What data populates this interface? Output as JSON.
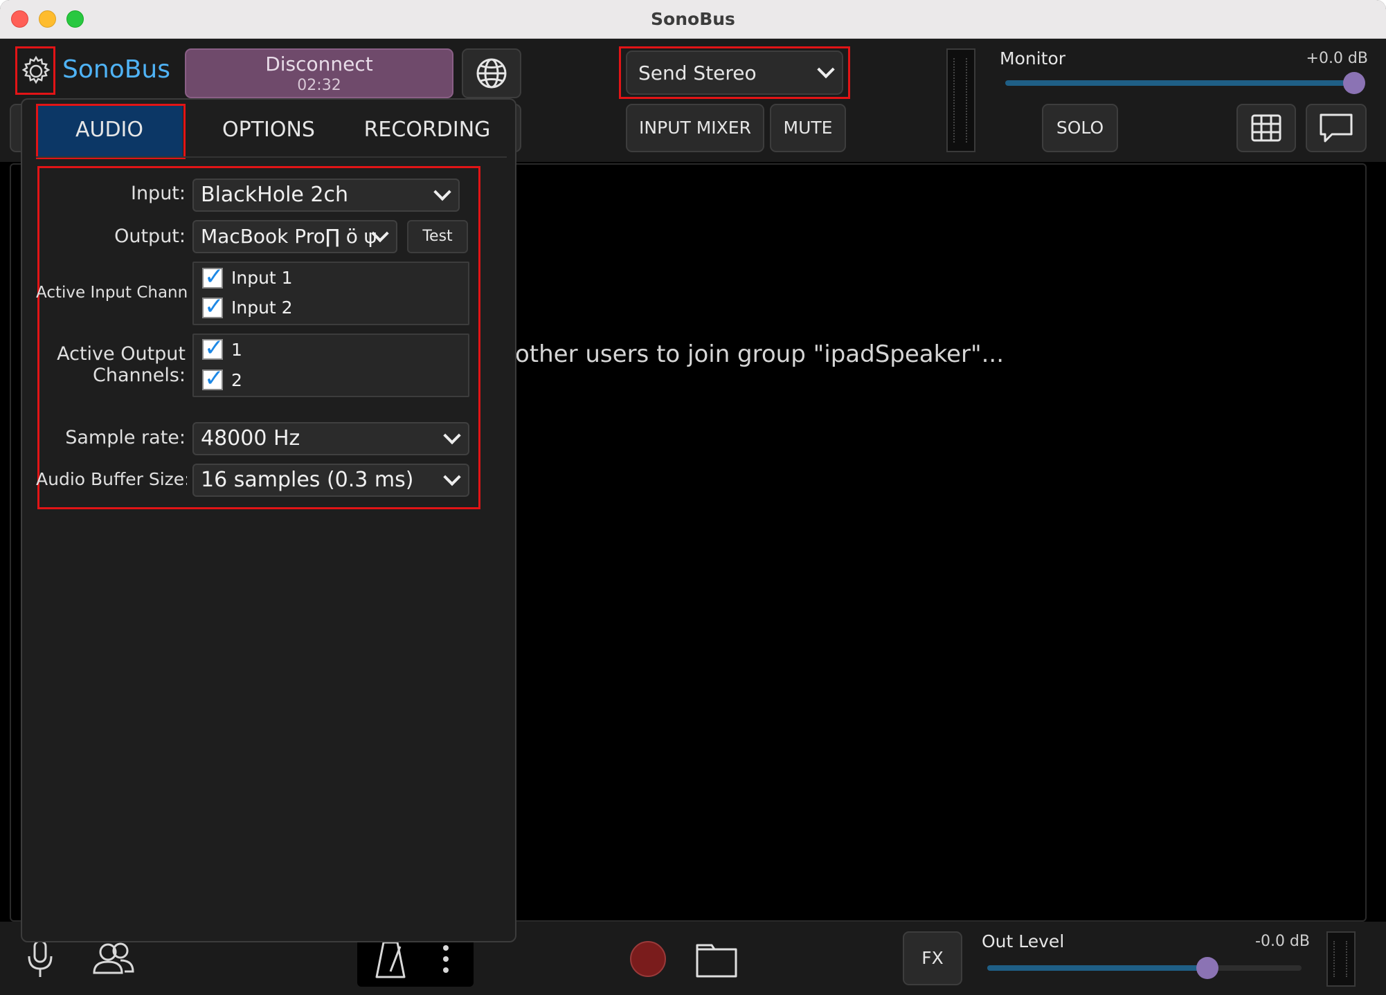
{
  "window": {
    "title": "SonoBus",
    "colors": {
      "close": "#ff5f57",
      "minimize": "#febc2e",
      "zoom": "#28c840"
    }
  },
  "header": {
    "app_name": "SonoBus",
    "disconnect_label": "Disconnect",
    "connection_time": "02:32",
    "send_mode": "Send Stereo",
    "input_mixer_label": "INPUT MIXER",
    "mute_label": "MUTE",
    "monitor_label": "Monitor",
    "monitor_value": "+0.0 dB",
    "monitor_level": 1.0,
    "solo_label": "SOLO"
  },
  "main": {
    "waiting_message": "other users to join group \"ipadSpeaker\"..."
  },
  "settings": {
    "tabs": [
      {
        "label": "AUDIO",
        "active": true
      },
      {
        "label": "OPTIONS",
        "active": false
      },
      {
        "label": "RECORDING",
        "active": false
      }
    ],
    "input_label": "Input:",
    "input_value": "BlackHole 2ch",
    "output_label": "Output:",
    "output_value": "MacBook Pro∏ ö ψ",
    "test_label": "Test",
    "active_input_label": "Active Input Channels:",
    "input_channels": [
      {
        "label": "Input 1",
        "checked": true
      },
      {
        "label": "Input 2",
        "checked": true
      }
    ],
    "active_output_label_1": "Active Output",
    "active_output_label_2": "Channels:",
    "output_channels": [
      {
        "label": "1",
        "checked": true
      },
      {
        "label": "2",
        "checked": true
      }
    ],
    "sample_rate_label": "Sample rate:",
    "sample_rate_value": "48000 Hz",
    "buffer_label": "Audio Buffer Size:",
    "buffer_value": "16 samples (0.3 ms)"
  },
  "footer": {
    "fx_label": "FX",
    "out_level_label": "Out Level",
    "out_level_value": "-0.0 dB",
    "out_level_position": 0.7
  },
  "accent": {
    "highlight": "#e21416",
    "brand": "#4fb3f6",
    "active_tab": "#0c3766",
    "record": "#7a1c1c"
  }
}
